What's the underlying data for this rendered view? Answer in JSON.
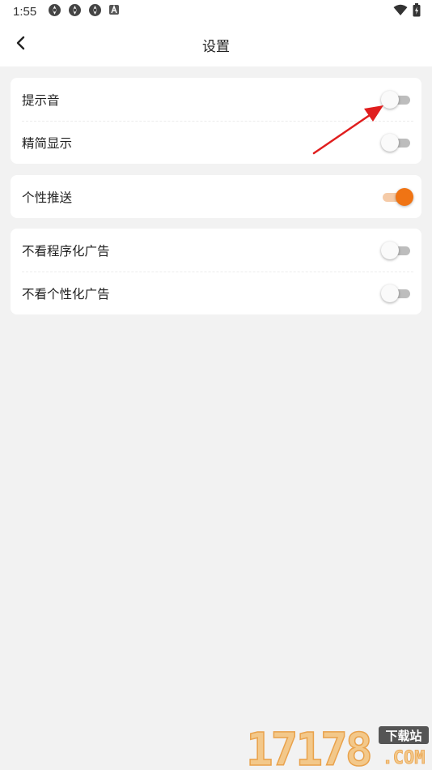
{
  "status_bar": {
    "time": "1:55",
    "icons": [
      "aperture-icon",
      "aperture-icon",
      "aperture-icon",
      "notification-a-icon"
    ],
    "right_icons": [
      "wifi-icon",
      "battery-charging-icon"
    ]
  },
  "header": {
    "back_icon": "chevron-left-icon",
    "title": "设置"
  },
  "settings": {
    "group1": [
      {
        "label": "提示音",
        "enabled": false
      },
      {
        "label": "精简显示",
        "enabled": false
      }
    ],
    "group2": [
      {
        "label": "个性推送",
        "enabled": true
      }
    ],
    "group3": [
      {
        "label": "不看程序化广告",
        "enabled": false
      },
      {
        "label": "不看个性化广告",
        "enabled": false
      }
    ]
  },
  "colors": {
    "accent": "#f07414",
    "accent_track": "#f5cba8",
    "toggle_off_track": "#bdbdbd",
    "page_background": "#f2f2f2",
    "annotation_arrow": "#e01e1e"
  },
  "watermark": {
    "number": "17178",
    "badge": "下载站",
    "domain": ".COM"
  }
}
